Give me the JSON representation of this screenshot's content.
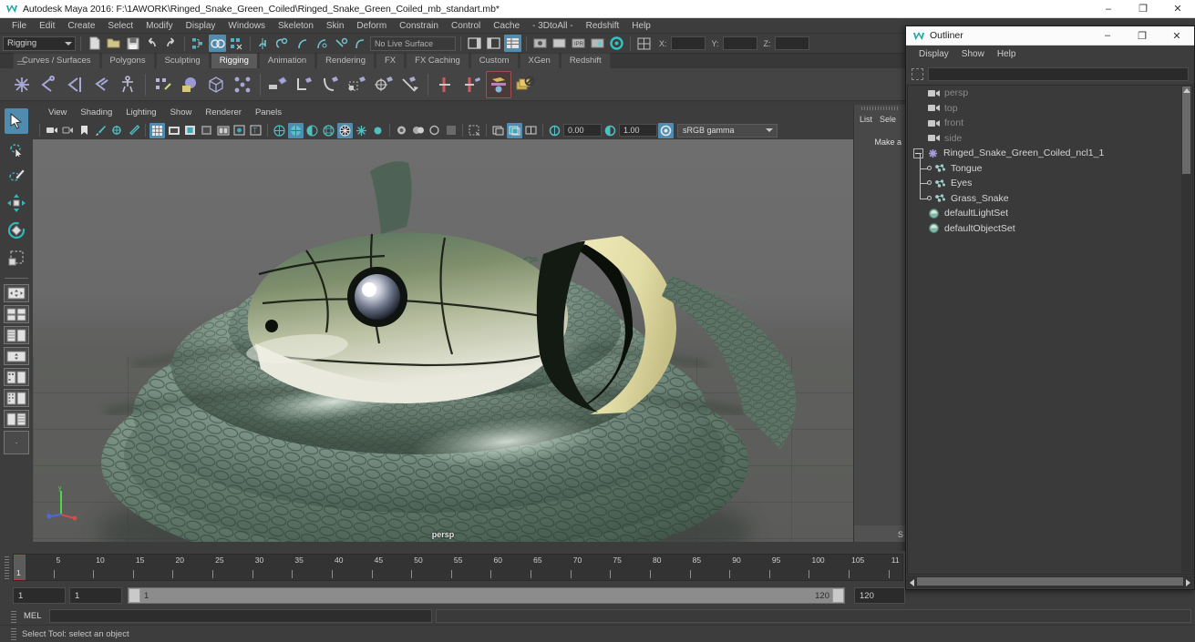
{
  "window": {
    "title": "Autodesk Maya 2016: F:\\1AWORK\\Ringed_Snake_Green_Coiled\\Ringed_Snake_Green_Coiled_mb_standart.mb*",
    "app_icon": "maya-icon",
    "minimize": "–",
    "maximize": "❐",
    "close": "✕"
  },
  "main_menu": {
    "items": [
      "File",
      "Edit",
      "Create",
      "Select",
      "Modify",
      "Display",
      "Windows",
      "Skeleton",
      "Skin",
      "Deform",
      "Constrain",
      "Control",
      "Cache",
      "- 3DtoAll -",
      "Redshift",
      "Help"
    ]
  },
  "status_line": {
    "menu_set": "Rigging",
    "live_surface": "No Live Surface",
    "coord_x_label": "X:",
    "coord_y_label": "Y:",
    "coord_z_label": "Z:",
    "coord_x_value": "",
    "coord_y_value": "",
    "coord_z_value": ""
  },
  "shelf": {
    "tabs": [
      "Curves / Surfaces",
      "Polygons",
      "Sculpting",
      "Rigging",
      "Animation",
      "Rendering",
      "FX",
      "FX Caching",
      "Custom",
      "XGen",
      "Redshift"
    ],
    "active_tab": "Rigging",
    "icons": [
      "create-joint-icon",
      "insert-joint-icon",
      "mirror-joint-icon",
      "connect-joint-icon",
      "ik-handle-icon",
      "bind-skin-icon",
      "smooth-bind-icon",
      "interactive-bind-icon",
      "paint-weights-icon",
      "parent-constraint-icon",
      "point-constraint-icon",
      "orient-constraint-icon",
      "scale-constraint-icon",
      "aim-constraint-icon",
      "pole-vector-icon",
      "lattice-icon",
      "wrap-deformer-icon",
      "blendshape-icon",
      "delete-history-icon"
    ]
  },
  "tool_column": {
    "tools": [
      "select-tool",
      "lasso-select-tool",
      "paint-select-tool",
      "move-tool",
      "rotate-tool",
      "scale-tool"
    ],
    "active_tool": "select-tool",
    "layouts": [
      "single-perspective-layout",
      "four-view-layout",
      "two-pane-side-layout",
      "outliner-persp-layout",
      "hypergraph-persp-layout",
      "persp-graph-layout",
      "two-stacked-layout",
      "blank-layout"
    ]
  },
  "viewport": {
    "menus": [
      "View",
      "Shading",
      "Lighting",
      "Show",
      "Renderer",
      "Panels"
    ],
    "camera_label": "persp",
    "exposure_value": "0.00",
    "gamma_value": "1.00",
    "color_profile": "sRGB gamma",
    "toolbar_icons": [
      "camera-icon",
      "camera-attributes-icon",
      "bookmark-icon",
      "paint-effects-icon",
      "2d-pan-zoom-icon",
      "grease-pencil-icon",
      "grid-icon",
      "film-gate-icon",
      "resolution-gate-icon",
      "gate-mask-icon",
      "exposure-icon",
      "xray-icon",
      "texture-icon",
      "wireframe-shading-icon",
      "smooth-shading-icon",
      "shaded-wireframe-icon",
      "textured-shading-icon",
      "use-all-lights-icon",
      "shadows-icon",
      "ao-icon",
      "motion-blur-icon",
      "multisample-icon",
      "depth-peeling-icon",
      "xray-joints-icon",
      "isolate-select-icon",
      "image-plane-icon",
      "render-region-icon"
    ],
    "axis_gizmo": {
      "x_color": "#d84a4a",
      "y_color": "#4ad84a",
      "z_color": "#4a6ad8"
    }
  },
  "channel_box": {
    "menus": [
      "List",
      "Sele"
    ],
    "message": "Make a",
    "footer": "S"
  },
  "outliner": {
    "title": "Outliner",
    "icon": "maya-icon",
    "minimize": "–",
    "maximize": "❐",
    "close": "✕",
    "menus": [
      "Display",
      "Show",
      "Help"
    ],
    "search_value": "",
    "search_icon": "filter-icon",
    "items": [
      {
        "label": "persp",
        "icon": "camera-icon",
        "indent": 0,
        "dim": true,
        "type": "camera"
      },
      {
        "label": "top",
        "icon": "camera-icon",
        "indent": 0,
        "dim": true,
        "type": "camera"
      },
      {
        "label": "front",
        "icon": "camera-icon",
        "indent": 0,
        "dim": true,
        "type": "camera"
      },
      {
        "label": "side",
        "icon": "camera-icon",
        "indent": 0,
        "dim": true,
        "type": "camera"
      },
      {
        "label": "Ringed_Snake_Green_Coiled_ncl1_1",
        "icon": "group-icon",
        "indent": 0,
        "dim": false,
        "type": "group",
        "expanded": true
      },
      {
        "label": "Tongue",
        "icon": "mesh-icon",
        "indent": 1,
        "dim": false,
        "type": "mesh"
      },
      {
        "label": "Eyes",
        "icon": "mesh-icon",
        "indent": 1,
        "dim": false,
        "type": "mesh"
      },
      {
        "label": "Grass_Snake",
        "icon": "mesh-icon",
        "indent": 1,
        "dim": false,
        "type": "mesh",
        "last": true
      },
      {
        "label": "defaultLightSet",
        "icon": "set-icon",
        "indent": 0,
        "dim": false,
        "type": "set"
      },
      {
        "label": "defaultObjectSet",
        "icon": "set-icon",
        "indent": 0,
        "dim": false,
        "type": "set"
      }
    ]
  },
  "timeline": {
    "ticks": [
      "5",
      "10",
      "15",
      "20",
      "25",
      "30",
      "35",
      "40",
      "45",
      "50",
      "55",
      "60",
      "65",
      "70",
      "75",
      "80",
      "85",
      "90",
      "95",
      "100",
      "105",
      "11"
    ],
    "current_frame": "1",
    "range_start": "1",
    "anim_start": "1",
    "slider_low": "1",
    "slider_high": "120",
    "anim_end": "120"
  },
  "command_line": {
    "label": "MEL",
    "input_value": "",
    "output_value": ""
  },
  "help_line": {
    "message": "Select Tool: select an object"
  },
  "colors": {
    "accent": "#4f8cb0",
    "panel_bg": "#3d3d3d",
    "shelf_bg": "#444444",
    "field_bg": "#2b2b2b",
    "text": "#d0d0d0"
  }
}
